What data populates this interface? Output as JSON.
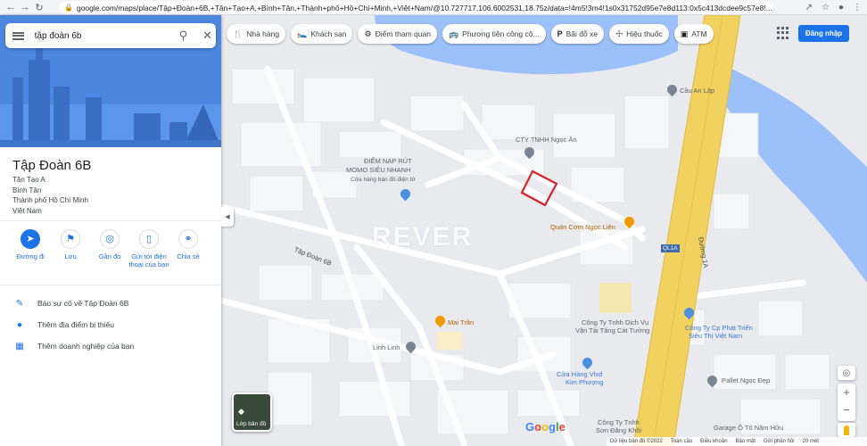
{
  "browser": {
    "url": "google.com/maps/place/Tập+Đoàn+6B,+Tân+Tạo+A,+Bình+Tân,+Thành+phố+Hồ+Chí+Minh,+Việt+Nam/@10.727717,106.6002531,18.75z/data=!4m5!3m4!1s0x31752d95e7e8d113:0x5c413dcdee9c57e8!..."
  },
  "search": {
    "value": "tập đoàn 6b"
  },
  "place": {
    "title": "Tập Đoàn 6B",
    "address_lines": [
      "Tân Tạo A",
      "Bình Tân",
      "Thành phố Hồ Chí Minh",
      "Việt Nam"
    ]
  },
  "actions": [
    {
      "label": "Đường đi",
      "icon": "directions-icon"
    },
    {
      "label": "Lưu",
      "icon": "bookmark-icon"
    },
    {
      "label": "Gần đó",
      "icon": "nearby-icon"
    },
    {
      "label": "Gửi tới điện thoại của bạn",
      "icon": "send-to-phone-icon"
    },
    {
      "label": "Chia sẻ",
      "icon": "share-icon"
    }
  ],
  "menu": [
    {
      "label": "Báo sự cố về Tập Đoàn 6B",
      "icon": "pencil-icon"
    },
    {
      "label": "Thêm địa điểm bị thiếu",
      "icon": "add-location-icon"
    },
    {
      "label": "Thêm doanh nghiệp của bạn",
      "icon": "business-icon"
    }
  ],
  "chips": [
    {
      "label": "Nhà hàng",
      "icon": "restaurant-icon"
    },
    {
      "label": "Khách sạn",
      "icon": "hotel-icon"
    },
    {
      "label": "Điểm tham quan",
      "icon": "attraction-icon"
    },
    {
      "label": "Phương tiện công cộ...",
      "icon": "transit-icon"
    },
    {
      "label": "Bãi đỗ xe",
      "icon": "parking-icon"
    },
    {
      "label": "Hiệu thuốc",
      "icon": "pharmacy-icon"
    },
    {
      "label": "ATM",
      "icon": "atm-icon"
    }
  ],
  "signin": "Đăng nhập",
  "map_labels": {
    "cty_ngoc_an": "CTY TNHH Ngọc Ân",
    "momo_1": "ĐIỂM NẠP RÚT",
    "momo_2": "MOMO SIÊU NHANH",
    "momo_3": "Cửa hàng bán đồ điện tử",
    "quan_com": "Quán Cơm Ngọc Liên",
    "tap_doan_6b": "Tập Đoàn 6B",
    "mai_tran": "Mai Trần",
    "linh_linh": "Linh Linh",
    "cau_an_lap": "Cầu An Lập",
    "duong_1a": "Đường 1A",
    "ql1a": "QL1A",
    "cty_dich_vu_1": "Công Ty Tnhh Dịch Vụ",
    "cty_dich_vu_2": "Vận Tải Tăng Cát Tường",
    "cty_phat_trien_1": "Công Ty Cp Phát Triển",
    "cty_phat_trien_2": "Siêu Thị Việt Nam",
    "cua_hang_vlxd_1": "Cửa Hàng Vlxd",
    "cua_hang_vlxd_2": "Kim Phượng",
    "pallet": "Pallet Ngọc Đẹp",
    "cty_tnhh_bottom_1": "Công Ty Tnhh",
    "cty_tnhh_bottom_2": "Sơn Đăng Khôi",
    "garage": "Garage Ô Tô Năm Hữu"
  },
  "watermark": "REVER",
  "layers_label": "Lớp bản đồ",
  "google_logo": [
    "G",
    "o",
    "o",
    "g",
    "l",
    "e"
  ],
  "footer": [
    "Dữ liệu bản đồ ©2022",
    "Toàn cầu",
    "Điều khoản",
    "Bảo mật",
    "Gửi phản hồi",
    "20 mét"
  ],
  "colors": {
    "accent": "#1a73e8",
    "water": "#9cc0f9",
    "highway": "#f2d25e",
    "selection": "#d9202c"
  }
}
